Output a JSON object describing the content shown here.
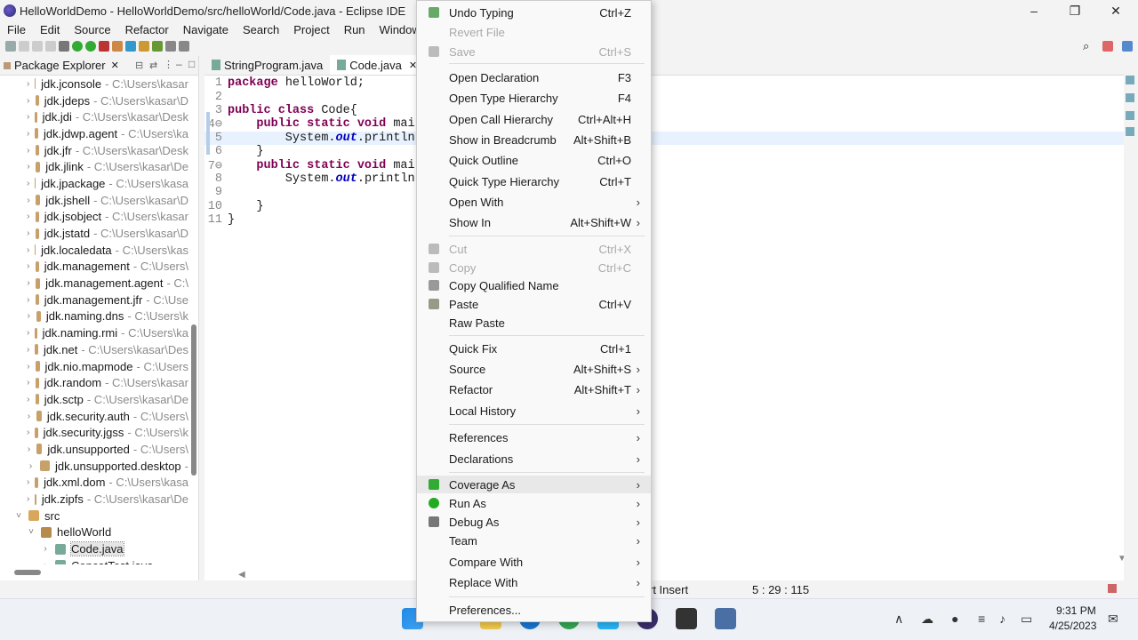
{
  "window": {
    "title": "HelloWorldDemo - HelloWorldDemo/src/helloWorld/Code.java - Eclipse IDE",
    "minimize": "–",
    "restore": "❐",
    "close": "✕"
  },
  "menubar": [
    "File",
    "Edit",
    "Source",
    "Refactor",
    "Navigate",
    "Search",
    "Project",
    "Run",
    "Window",
    "Help"
  ],
  "explorer": {
    "title": "Package Explorer",
    "items": [
      {
        "name": "jdk.jconsole",
        "path": "- C:\\Users\\kasar"
      },
      {
        "name": "jdk.jdeps",
        "path": "- C:\\Users\\kasar\\D"
      },
      {
        "name": "jdk.jdi",
        "path": "- C:\\Users\\kasar\\Desk"
      },
      {
        "name": "jdk.jdwp.agent",
        "path": "- C:\\Users\\ka"
      },
      {
        "name": "jdk.jfr",
        "path": "- C:\\Users\\kasar\\Desk"
      },
      {
        "name": "jdk.jlink",
        "path": "- C:\\Users\\kasar\\De"
      },
      {
        "name": "jdk.jpackage",
        "path": "- C:\\Users\\kasa"
      },
      {
        "name": "jdk.jshell",
        "path": "- C:\\Users\\kasar\\D"
      },
      {
        "name": "jdk.jsobject",
        "path": "- C:\\Users\\kasar"
      },
      {
        "name": "jdk.jstatd",
        "path": "- C:\\Users\\kasar\\D"
      },
      {
        "name": "jdk.localedata",
        "path": "- C:\\Users\\kas"
      },
      {
        "name": "jdk.management",
        "path": "- C:\\Users\\"
      },
      {
        "name": "jdk.management.agent",
        "path": "- C:\\"
      },
      {
        "name": "jdk.management.jfr",
        "path": "- C:\\Use"
      },
      {
        "name": "jdk.naming.dns",
        "path": "- C:\\Users\\k"
      },
      {
        "name": "jdk.naming.rmi",
        "path": "- C:\\Users\\ka"
      },
      {
        "name": "jdk.net",
        "path": "- C:\\Users\\kasar\\Des"
      },
      {
        "name": "jdk.nio.mapmode",
        "path": "- C:\\Users"
      },
      {
        "name": "jdk.random",
        "path": "- C:\\Users\\kasar"
      },
      {
        "name": "jdk.sctp",
        "path": "- C:\\Users\\kasar\\De"
      },
      {
        "name": "jdk.security.auth",
        "path": "- C:\\Users\\"
      },
      {
        "name": "jdk.security.jgss",
        "path": "- C:\\Users\\k"
      },
      {
        "name": "jdk.unsupported",
        "path": "- C:\\Users\\"
      },
      {
        "name": "jdk.unsupported.desktop",
        "path": "-"
      },
      {
        "name": "jdk.xml.dom",
        "path": "- C:\\Users\\kasa"
      },
      {
        "name": "jdk.zipfs",
        "path": "- C:\\Users\\kasar\\De"
      }
    ],
    "src": "src",
    "package": "helloWorld",
    "files": [
      "Code.java",
      "ConcatTest.java"
    ]
  },
  "editor": {
    "tabs": [
      "StringProgram.java",
      "Code.java"
    ],
    "lines": [
      {
        "n": "1",
        "parts": [
          [
            "kw",
            "package"
          ],
          [
            "",
            " helloWorld;"
          ]
        ]
      },
      {
        "n": "2",
        "parts": []
      },
      {
        "n": "3",
        "parts": [
          [
            "kw",
            "public class"
          ],
          [
            "",
            " Code{"
          ]
        ]
      },
      {
        "n": "4⊖",
        "parts": [
          [
            "",
            "    "
          ],
          [
            "kw",
            "public static void"
          ],
          [
            "",
            " mai"
          ]
        ]
      },
      {
        "n": "5",
        "parts": [
          [
            "",
            "        System."
          ],
          [
            "fld",
            "out"
          ],
          [
            "",
            ".println"
          ]
        ]
      },
      {
        "n": "6",
        "parts": [
          [
            "",
            "    }"
          ]
        ]
      },
      {
        "n": "7⊖",
        "parts": [
          [
            "",
            "    "
          ],
          [
            "kw",
            "public static void"
          ],
          [
            "",
            " mai"
          ]
        ]
      },
      {
        "n": "8",
        "parts": [
          [
            "",
            "        System."
          ],
          [
            "fld",
            "out"
          ],
          [
            "",
            ".println"
          ]
        ]
      },
      {
        "n": "9",
        "parts": []
      },
      {
        "n": "10",
        "parts": [
          [
            "",
            "    }"
          ]
        ]
      },
      {
        "n": "11",
        "parts": [
          [
            "",
            "}"
          ]
        ]
      }
    ]
  },
  "statusbar": {
    "insert_mode": "rt Insert",
    "position": "5 : 29 : 115"
  },
  "context_menu": {
    "items": [
      {
        "label": "Undo Typing",
        "shortcut": "Ctrl+Z",
        "disabled": false,
        "icon": "undo"
      },
      {
        "label": "Revert File",
        "shortcut": "",
        "disabled": true
      },
      {
        "label": "Save",
        "shortcut": "Ctrl+S",
        "disabled": true,
        "icon": "save"
      },
      {
        "sep": true
      },
      {
        "label": "Open Declaration",
        "shortcut": "F3"
      },
      {
        "label": "Open Type Hierarchy",
        "shortcut": "F4"
      },
      {
        "label": "Open Call Hierarchy",
        "shortcut": "Ctrl+Alt+H"
      },
      {
        "label": "Show in Breadcrumb",
        "shortcut": "Alt+Shift+B"
      },
      {
        "label": "Quick Outline",
        "shortcut": "Ctrl+O"
      },
      {
        "label": "Quick Type Hierarchy",
        "shortcut": "Ctrl+T"
      },
      {
        "label": "Open With",
        "shortcut": "",
        "submenu": true
      },
      {
        "label": "Show In",
        "shortcut": "Alt+Shift+W",
        "submenu": true
      },
      {
        "sep": true
      },
      {
        "label": "Cut",
        "shortcut": "Ctrl+X",
        "disabled": true,
        "icon": "cut"
      },
      {
        "label": "Copy",
        "shortcut": "Ctrl+C",
        "disabled": true,
        "icon": "copy"
      },
      {
        "label": "Copy Qualified Name",
        "shortcut": "",
        "icon": "copy-qn"
      },
      {
        "label": "Paste",
        "shortcut": "Ctrl+V",
        "icon": "paste"
      },
      {
        "label": "Raw Paste",
        "shortcut": ""
      },
      {
        "sep": true
      },
      {
        "label": "Quick Fix",
        "shortcut": "Ctrl+1"
      },
      {
        "label": "Source",
        "shortcut": "Alt+Shift+S",
        "submenu": true
      },
      {
        "label": "Refactor",
        "shortcut": "Alt+Shift+T",
        "submenu": true
      },
      {
        "label": "Local History",
        "shortcut": "",
        "submenu": true
      },
      {
        "sep": true
      },
      {
        "label": "References",
        "shortcut": "",
        "submenu": true
      },
      {
        "label": "Declarations",
        "shortcut": "",
        "submenu": true
      },
      {
        "sep": true
      },
      {
        "label": "Coverage As",
        "shortcut": "",
        "submenu": true,
        "icon": "coverage",
        "hover": true
      },
      {
        "label": "Run As",
        "shortcut": "",
        "submenu": true,
        "icon": "run"
      },
      {
        "label": "Debug As",
        "shortcut": "",
        "submenu": true,
        "icon": "debug"
      },
      {
        "label": "Team",
        "shortcut": "",
        "submenu": true
      },
      {
        "label": "Compare With",
        "shortcut": "",
        "submenu": true
      },
      {
        "label": "Replace With",
        "shortcut": "",
        "submenu": true
      },
      {
        "sep": true
      },
      {
        "label": "Preferences...",
        "shortcut": ""
      }
    ]
  },
  "taskbar": {
    "time": "9:31 PM",
    "date": "4/25/2023"
  },
  "colors": {
    "keyword": "#7f0055",
    "field": "#0000c0",
    "current_line": "#e8f2fe",
    "menu_bg": "#f9f9f9"
  }
}
